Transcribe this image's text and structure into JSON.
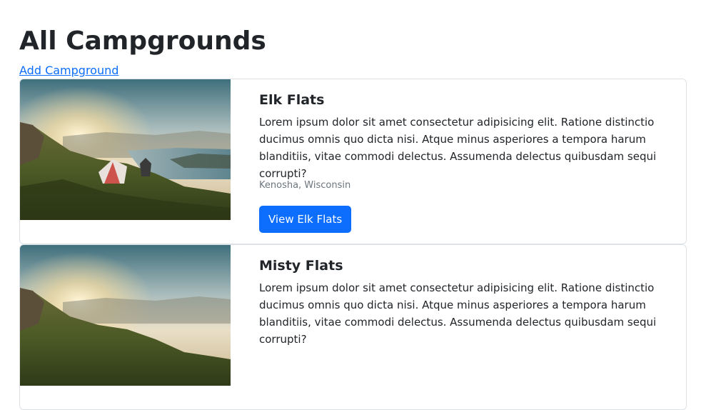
{
  "page": {
    "title": "All Campgrounds",
    "add_link": "Add Campground"
  },
  "campgrounds": [
    {
      "title": "Elk Flats",
      "description": "Lorem ipsum dolor sit amet consectetur adipisicing elit. Ratione distinctio ducimus omnis quo dicta nisi. Atque minus asperiores a tempora harum blanditiis, vitae commodi delectus. Assumenda delectus quibusdam sequi corrupti?",
      "location": "Kenosha, Wisconsin",
      "button_label": "View Elk Flats"
    },
    {
      "title": "Misty Flats",
      "description": "Lorem ipsum dolor sit amet consectetur adipisicing elit. Ratione distinctio ducimus omnis quo dicta nisi. Atque minus asperiores a tempora harum blanditiis, vitae commodi delectus. Assumenda delectus quibusdam sequi corrupti?",
      "location": "",
      "button_label": ""
    }
  ],
  "colors": {
    "link": "#0d6efd",
    "button": "#0d6efd",
    "muted": "#6c757d",
    "text": "#212529",
    "border": "#dee2e6"
  }
}
